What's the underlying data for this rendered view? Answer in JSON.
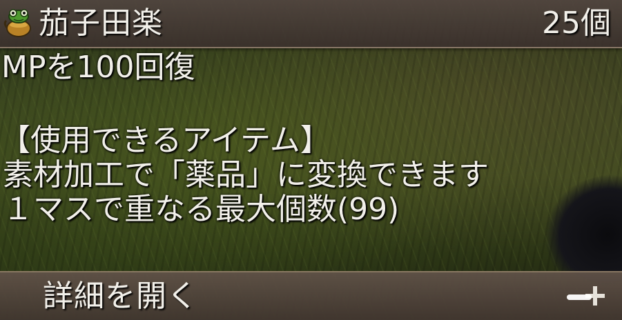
{
  "item": {
    "icon": "frog-pot-icon",
    "name": "茄子田楽",
    "count": "25個"
  },
  "description": {
    "line1": "MPを100回復",
    "line2": "【使用できるアイテム】",
    "line3": "素材加工で「薬品」に変換できます",
    "line4": "１マスで重なる最大個数(99)"
  },
  "footer": {
    "details_label": "詳細を開く",
    "expand_icon": "plus-icon"
  },
  "colors": {
    "text": "#f2f0ea",
    "header_bg": "#52463f",
    "footer_bg": "#605248",
    "icon_green": "#4e9a2e",
    "icon_gold": "#c08a2a"
  }
}
